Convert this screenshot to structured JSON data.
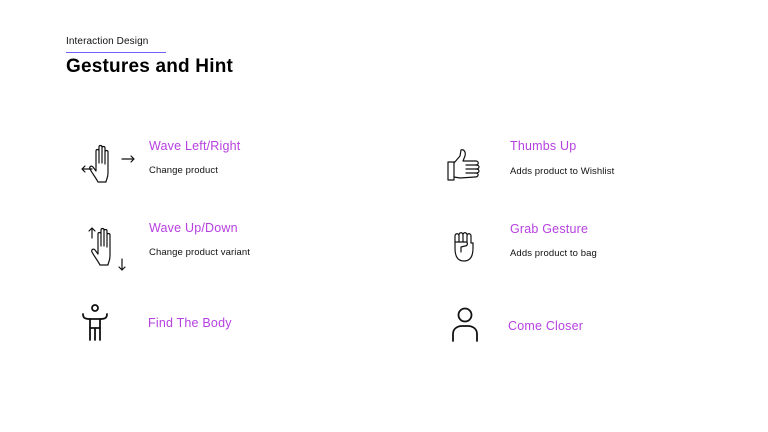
{
  "header": {
    "eyebrow": "Interaction Design",
    "title": "Gestures and Hint"
  },
  "colors": {
    "accent_text": "#b640e0",
    "rule": "#6c63ff",
    "ink": "#111111"
  },
  "gestures": [
    {
      "icon": "wave-left-right-hand-icon",
      "name": "Wave Left/Right",
      "hint": "Change product"
    },
    {
      "icon": "thumbs-up-icon",
      "name": "Thumbs Up",
      "hint": "Adds product to Wishlist"
    },
    {
      "icon": "wave-up-down-hand-icon",
      "name": "Wave Up/Down",
      "hint": "Change product variant"
    },
    {
      "icon": "grab-fist-icon",
      "name": "Grab Gesture",
      "hint": "Adds product to bag"
    },
    {
      "icon": "body-figure-icon",
      "name": "Find The Body",
      "hint": ""
    },
    {
      "icon": "person-icon",
      "name": "Come Closer",
      "hint": ""
    }
  ]
}
